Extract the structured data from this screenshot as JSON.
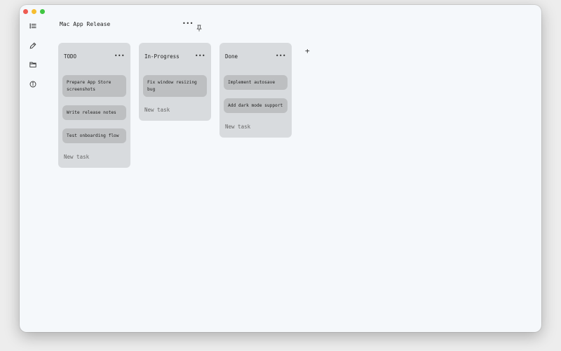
{
  "window": {
    "controls": [
      "close",
      "minimize",
      "zoom"
    ]
  },
  "sidebar": {
    "items": [
      {
        "icon": "list-icon"
      },
      {
        "icon": "pen-icon"
      },
      {
        "icon": "folder-icon"
      },
      {
        "icon": "info-icon"
      }
    ]
  },
  "board": {
    "title": "Mac App Release",
    "more_label": "•••",
    "pin_icon": "pin-icon",
    "add_column_label": "+"
  },
  "columns": [
    {
      "title": "TODO",
      "more_label": "•••",
      "cards": [
        "Prepare App Store screenshots",
        "Write release notes",
        "Test onboarding flow"
      ],
      "new_task_label": "New task"
    },
    {
      "title": "In-Progress",
      "more_label": "•••",
      "cards": [
        "Fix window resizing bug"
      ],
      "new_task_label": "New task"
    },
    {
      "title": "Done",
      "more_label": "•••",
      "cards": [
        "Implement autosave",
        "Add dark mode support"
      ],
      "new_task_label": "New task"
    }
  ],
  "colors": {
    "background": "#f5f8fb",
    "column": "#d8dbde",
    "card": "#bdbfc1",
    "close": "#ee5b52",
    "minimize": "#f6bd2f",
    "zoom": "#3fc641"
  }
}
